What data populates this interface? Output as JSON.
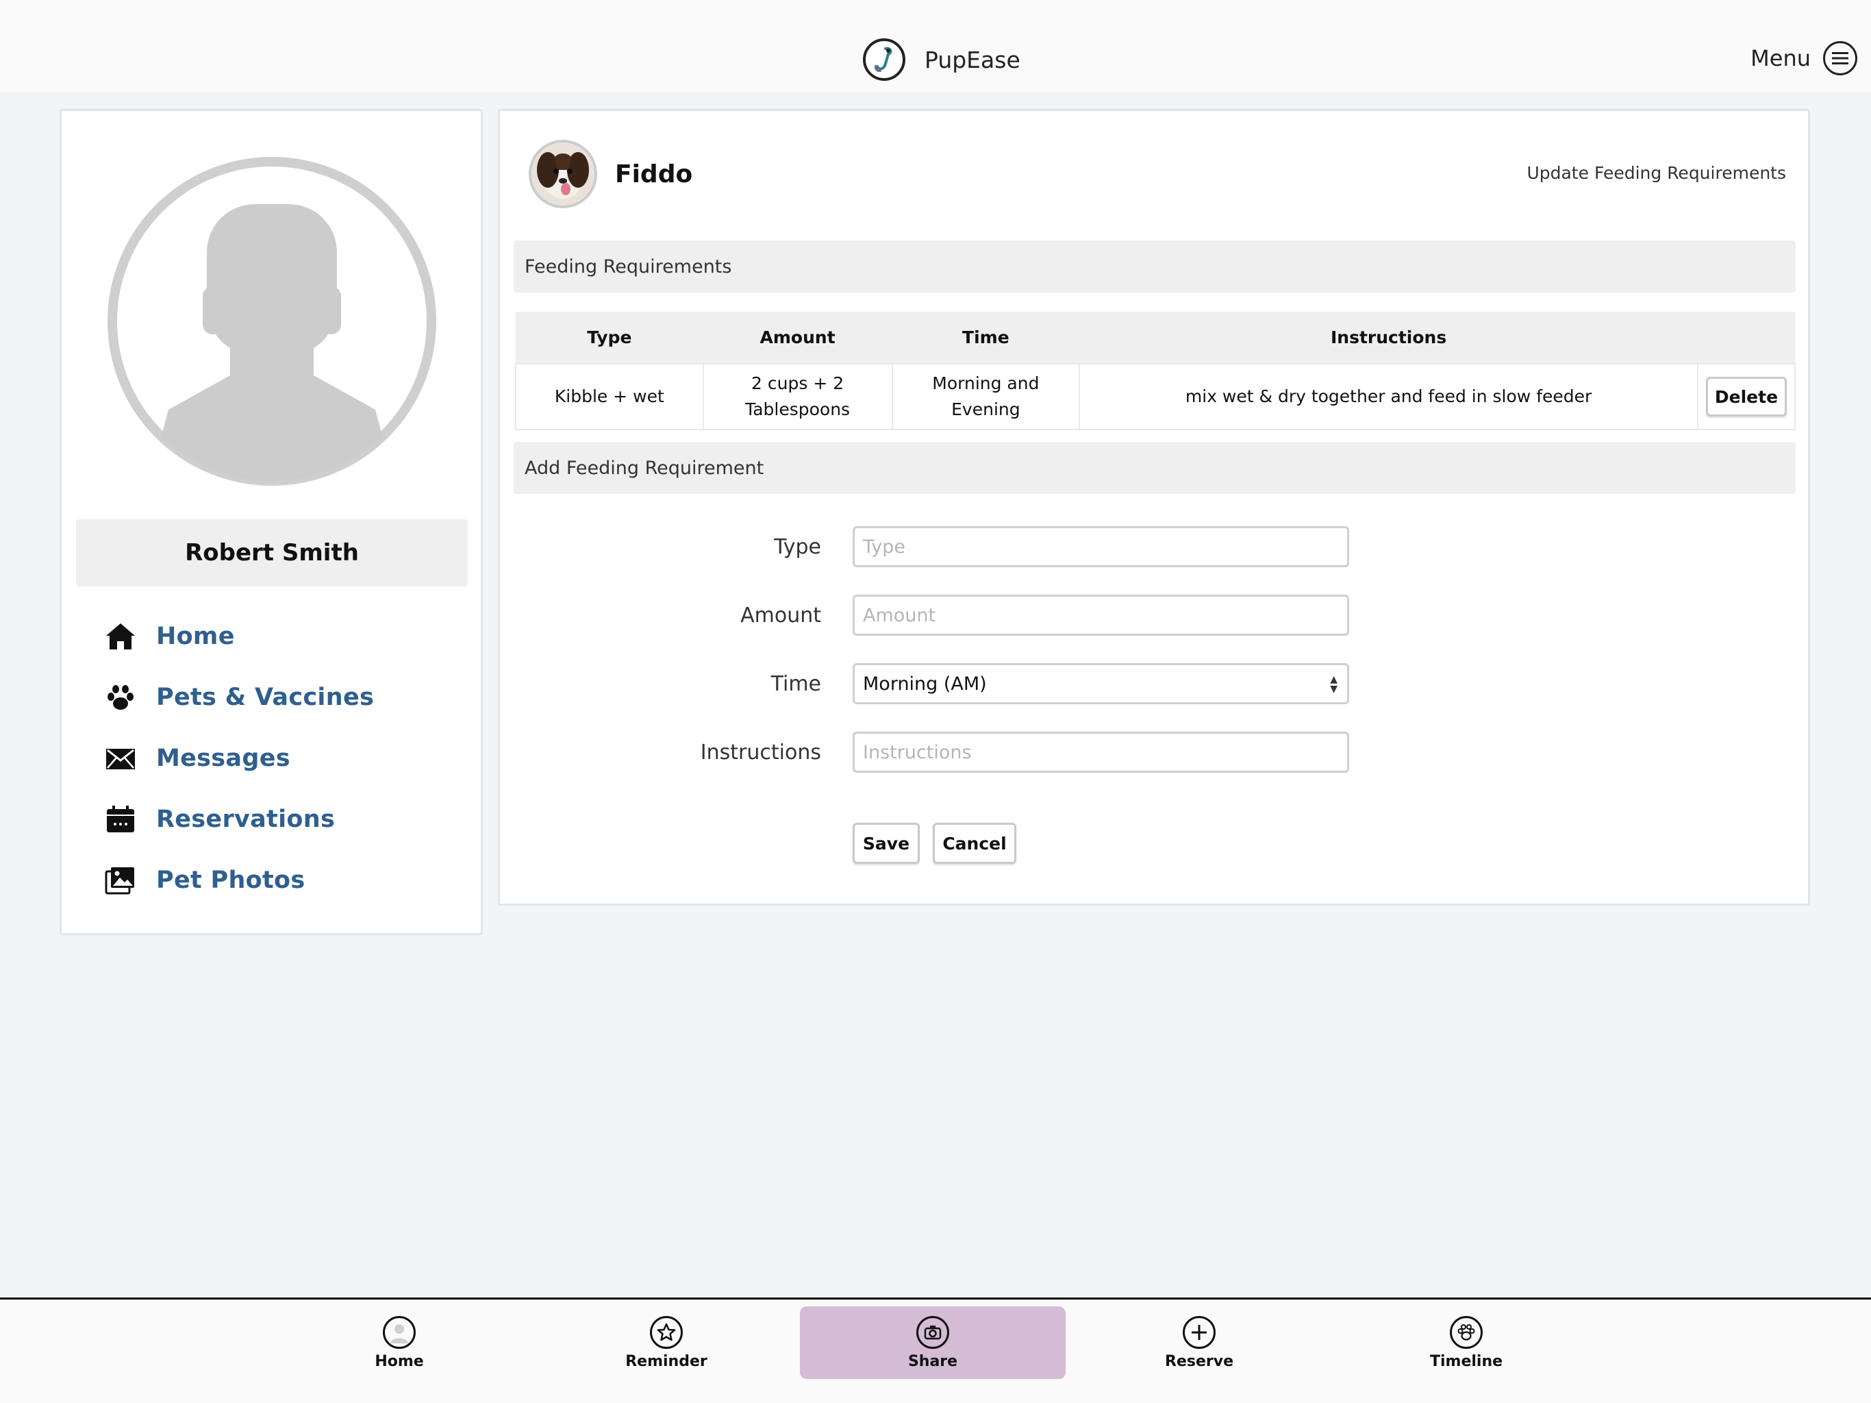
{
  "header": {
    "brand_name": "PupEase",
    "menu_label": "Menu"
  },
  "sidebar": {
    "user_name": "Robert Smith",
    "nav": [
      {
        "label": "Home",
        "icon": "home-icon"
      },
      {
        "label": "Pets & Vaccines",
        "icon": "paw-icon"
      },
      {
        "label": "Messages",
        "icon": "envelope-icon"
      },
      {
        "label": "Reservations",
        "icon": "calendar-icon"
      },
      {
        "label": "Pet Photos",
        "icon": "photos-icon"
      }
    ]
  },
  "pet": {
    "name": "Fiddo",
    "update_link": "Update Feeding Requirements"
  },
  "feeding": {
    "section_title": "Feeding Requirements",
    "columns": [
      "Type",
      "Amount",
      "Time",
      "Instructions"
    ],
    "rows": [
      {
        "type": "Kibble + wet",
        "amount": "2 cups + 2 Tablespoons",
        "time": "Morning and Evening",
        "instructions": "mix wet & dry together and feed in slow feeder",
        "delete_label": "Delete"
      }
    ]
  },
  "add_form": {
    "section_title": "Add Feeding Requirement",
    "type_label": "Type",
    "type_placeholder": "Type",
    "amount_label": "Amount",
    "amount_placeholder": "Amount",
    "time_label": "Time",
    "time_selected": "Morning (AM)",
    "instructions_label": "Instructions",
    "instructions_placeholder": "Instructions",
    "save_label": "Save",
    "cancel_label": "Cancel"
  },
  "bottom_nav": [
    {
      "label": "Home",
      "icon": "person-icon",
      "active": false
    },
    {
      "label": "Reminder",
      "icon": "star-icon",
      "active": false
    },
    {
      "label": "Share",
      "icon": "camera-icon",
      "active": true
    },
    {
      "label": "Reserve",
      "icon": "plus-icon",
      "active": false
    },
    {
      "label": "Timeline",
      "icon": "paw-icon",
      "active": false
    }
  ],
  "colors": {
    "nav_link": "#2f5f8f",
    "active_tab": "#d3bcd4",
    "page_bg": "#f2f5f8"
  }
}
